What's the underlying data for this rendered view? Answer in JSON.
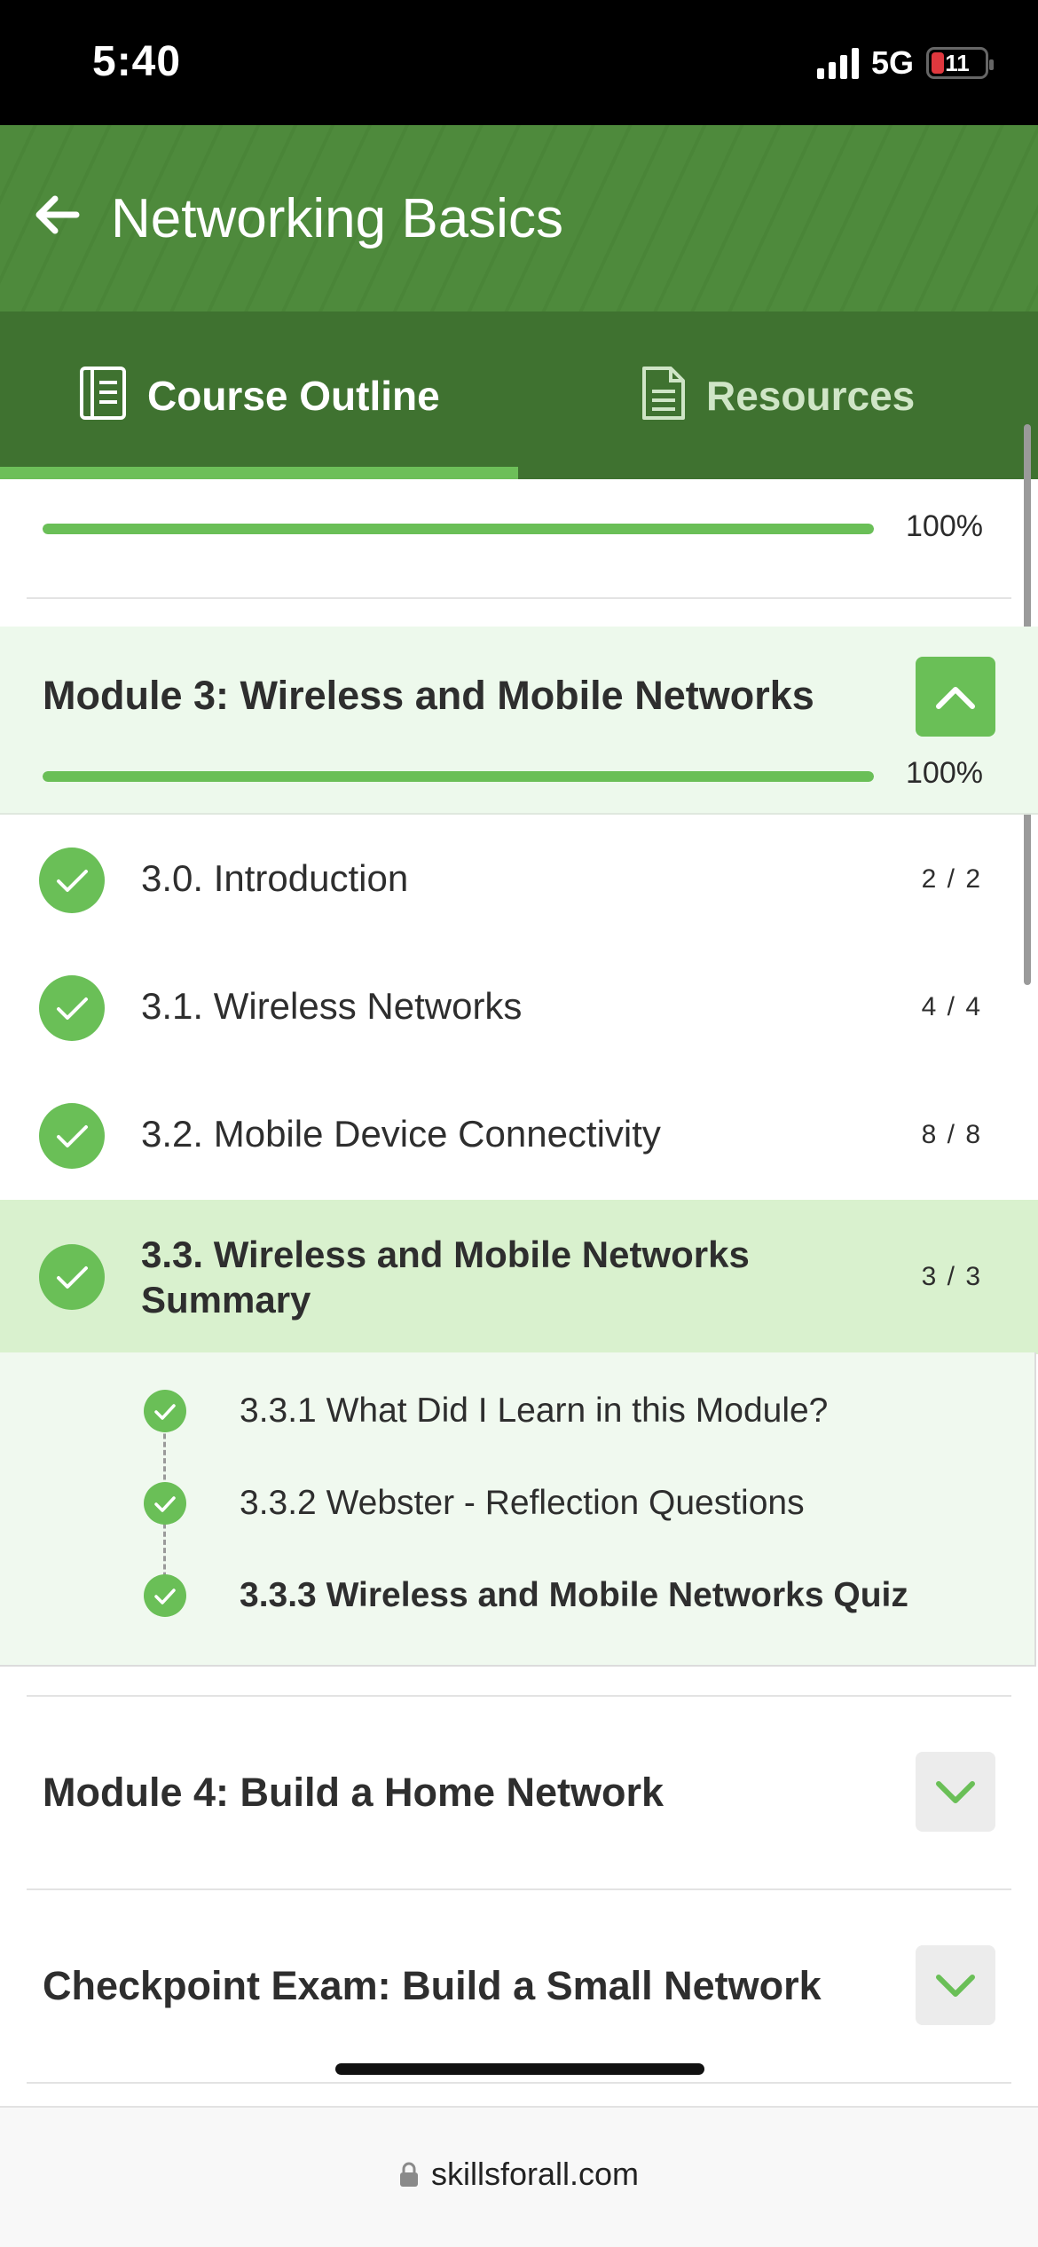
{
  "status_bar": {
    "time": "5:40",
    "network": "5G",
    "battery": "11"
  },
  "header": {
    "title": "Networking Basics"
  },
  "tabs": [
    {
      "label": "Course Outline",
      "active": true,
      "icon": "book-icon"
    },
    {
      "label": "Resources",
      "active": false,
      "icon": "document-icon"
    }
  ],
  "overall_progress": {
    "percent_text": "100%",
    "value": 1.0
  },
  "module3": {
    "title": "Module 3: Wireless and Mobile Networks",
    "percent_text": "100%",
    "progress_value": 1.0,
    "expanded": true,
    "lessons": [
      {
        "label": "3.0. Introduction",
        "count": "2 / 2",
        "completed": true
      },
      {
        "label": "3.1. Wireless Networks",
        "count": "4 / 4",
        "completed": true
      },
      {
        "label": "3.2. Mobile Device Connectivity",
        "count": "8 / 8",
        "completed": true
      },
      {
        "label": "3.3. Wireless and Mobile Networks Summary",
        "count": "3 / 3",
        "completed": true,
        "active": true
      }
    ],
    "sub_items": [
      {
        "label": "3.3.1 What Did I Learn in this Module?",
        "completed": true
      },
      {
        "label": "3.3.2 Webster - Reflection Questions",
        "completed": true
      },
      {
        "label": "3.3.3 Wireless and Mobile Networks Quiz",
        "completed": true,
        "current": true
      }
    ]
  },
  "collapsed_modules": [
    {
      "title": "Module 4: Build a Home Network"
    },
    {
      "title": "Checkpoint Exam: Build a Small Network"
    }
  ],
  "browser": {
    "url": "skillsforall.com"
  },
  "colors": {
    "header_green": "#4e8a3c",
    "tabs_green": "#3f7230",
    "accent_green": "#6abf57",
    "active_lesson_bg": "#d9f1ce",
    "module_bg": "#edf9ec"
  }
}
